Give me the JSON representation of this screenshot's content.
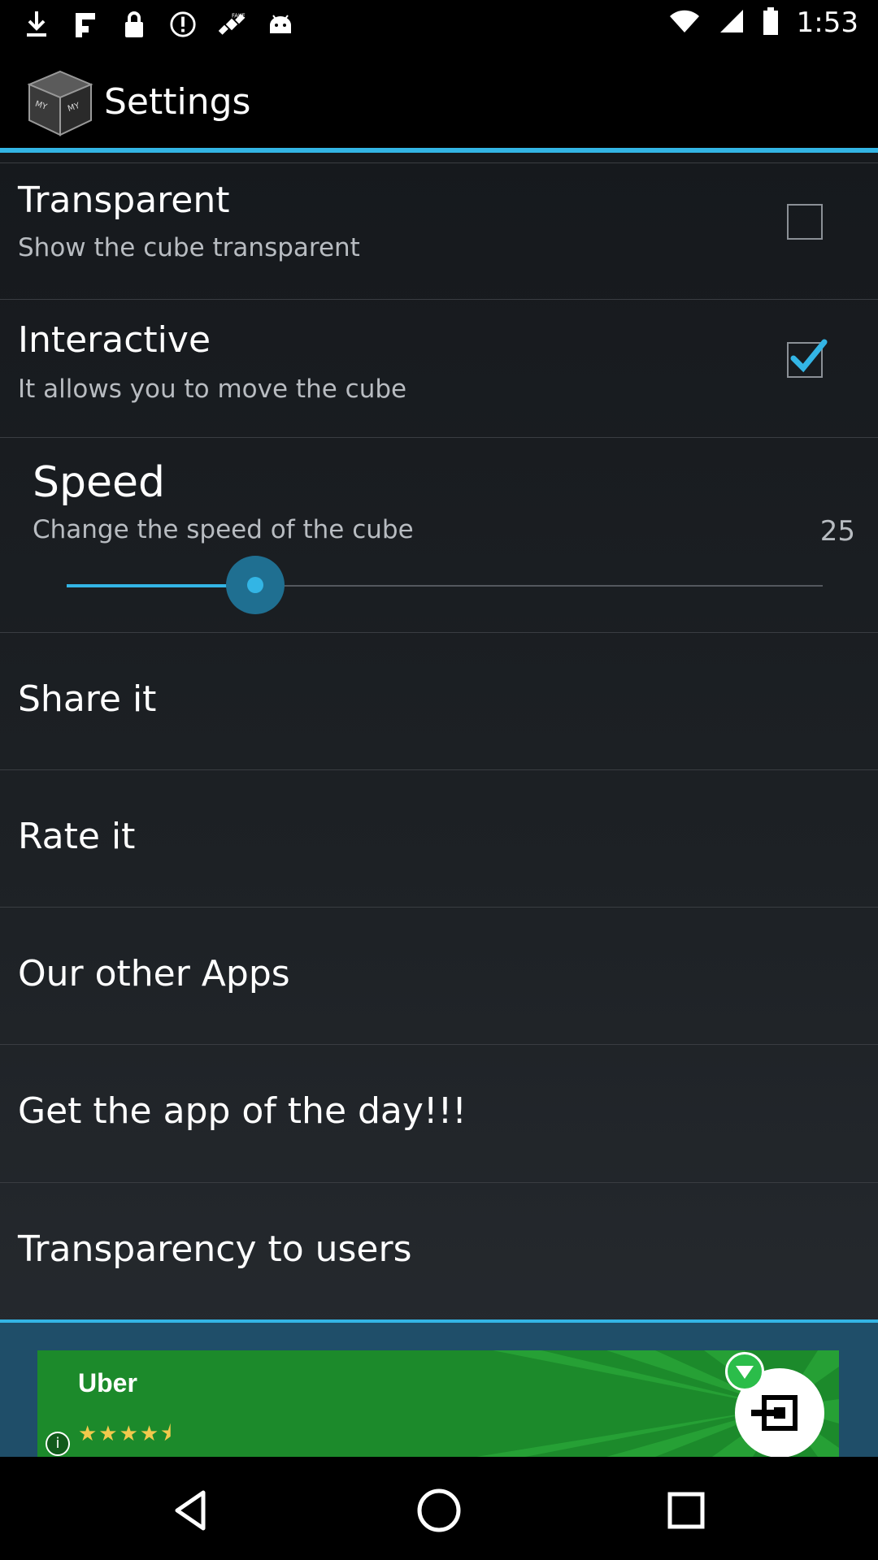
{
  "status_bar": {
    "time": "1:53",
    "icons": [
      "download-icon",
      "flipboard-icon",
      "lock-icon",
      "alert-icon",
      "fake-gps-icon",
      "android-icon",
      "wifi-icon",
      "signal-icon",
      "battery-icon"
    ]
  },
  "action_bar": {
    "title": "Settings",
    "logo_text": "MY NAME"
  },
  "preferences": {
    "transparent": {
      "title": "Transparent",
      "summary": "Show the cube transparent",
      "checked": false
    },
    "interactive": {
      "title": "Interactive",
      "summary": "It allows you to move the cube",
      "checked": true
    },
    "speed": {
      "title": "Speed",
      "summary": "Change the speed of the cube",
      "value": "25"
    },
    "share": {
      "title": "Share it"
    },
    "rate": {
      "title": "Rate it"
    },
    "other_apps": {
      "title": "Our other Apps"
    },
    "app_of_day": {
      "title": "Get the app of the day!!!"
    },
    "transparency": {
      "title": "Transparency to users"
    }
  },
  "ad": {
    "name": "Uber",
    "rating_stars": "★★★★⯨",
    "info_symbol": "i"
  },
  "colors": {
    "accent": "#33b5e5",
    "ad_background": "#1c8a2b"
  }
}
